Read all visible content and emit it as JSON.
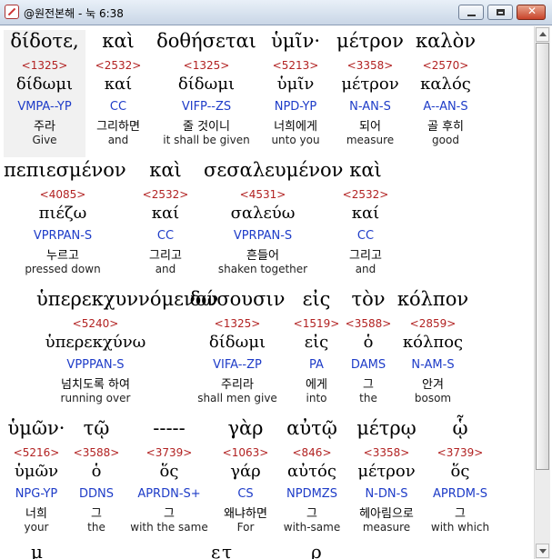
{
  "window": {
    "title": "@원전본해 - 눅 6:38",
    "minimize_label": "minimize",
    "maximize_label": "maximize",
    "close_label": "✕"
  },
  "rows": [
    {
      "words": [
        {
          "greek": "δίδοτε,",
          "strong": "<1325>",
          "lemma": "δίδωμι",
          "parse": "VMPA--YP",
          "korean": "주라",
          "english": "Give"
        },
        {
          "greek": "καὶ",
          "strong": "<2532>",
          "lemma": "καί",
          "parse": "CC",
          "korean": "그리하면",
          "english": "and"
        },
        {
          "greek": "δοθήσεται",
          "strong": "<1325>",
          "lemma": "δίδωμι",
          "parse": "VIFP--ZS",
          "korean": "줄 것이니",
          "english": "it shall be given"
        },
        {
          "greek": "ὑμῖν·",
          "strong": "<5213>",
          "lemma": "ὑμῖν",
          "parse": "NPD-YP",
          "korean": "너희에게",
          "english": "unto you"
        },
        {
          "greek": "μέτρον",
          "strong": "<3358>",
          "lemma": "μέτρον",
          "parse": "N-AN-S",
          "korean": "되어",
          "english": "measure"
        },
        {
          "greek": "καλὸν",
          "strong": "<2570>",
          "lemma": "καλός",
          "parse": "A--AN-S",
          "korean": "골 후히",
          "english": "good"
        }
      ]
    },
    {
      "words": [
        {
          "greek": "πεπιεσμένον",
          "strong": "<4085>",
          "lemma": "πιέζω",
          "parse": "VPRPAN-S",
          "korean": "누르고",
          "english": "pressed down"
        },
        {
          "greek": "καὶ",
          "strong": "<2532>",
          "lemma": "καί",
          "parse": "CC",
          "korean": "그리고",
          "english": "and"
        },
        {
          "greek": "σεσαλευμένον",
          "strong": "<4531>",
          "lemma": "σαλεύω",
          "parse": "VPRPAN-S",
          "korean": "흔들어",
          "english": "shaken together"
        },
        {
          "greek": "καὶ",
          "strong": "<2532>",
          "lemma": "καί",
          "parse": "CC",
          "korean": "그리고",
          "english": "and"
        }
      ]
    },
    {
      "words": [
        {
          "greek": "ὑπερεκχυννόμενον",
          "strong": "<5240>",
          "lemma": "ὑπερεκχύνω",
          "parse": "VPPPAN-S",
          "korean": "넘치도록 하여",
          "english": "running over"
        },
        {
          "greek": "δώσουσιν",
          "strong": "<1325>",
          "lemma": "δίδωμι",
          "parse": "VIFA--ZP",
          "korean": "주리라",
          "english": "shall men give"
        },
        {
          "greek": "εἰς",
          "strong": "<1519>",
          "lemma": "εἰς",
          "parse": "PA",
          "korean": "에게",
          "english": "into"
        },
        {
          "greek": "τὸν",
          "strong": "<3588>",
          "lemma": "ὁ",
          "parse": "DAMS",
          "korean": "그",
          "english": "the"
        },
        {
          "greek": "κόλπον",
          "strong": "<2859>",
          "lemma": "κόλπος",
          "parse": "N-AM-S",
          "korean": "안겨",
          "english": "bosom"
        }
      ]
    },
    {
      "words": [
        {
          "greek": "ὑμῶν·",
          "strong": "<5216>",
          "lemma": "ὑμῶν",
          "parse": "NPG-YP",
          "korean": "너희",
          "english": "your"
        },
        {
          "greek": "τῷ",
          "strong": "<3588>",
          "lemma": "ὁ",
          "parse": "DDNS",
          "korean": "그",
          "english": "the"
        },
        {
          "greek": "-----",
          "strong": "<3739>",
          "lemma": "ὅς",
          "parse": "APRDN-S+",
          "korean": "그",
          "english": "with the same"
        },
        {
          "greek": "γὰρ",
          "strong": "<1063>",
          "lemma": "γάρ",
          "parse": "CS",
          "korean": "왜냐하면",
          "english": "For"
        },
        {
          "greek": "αὐτῷ",
          "strong": "<846>",
          "lemma": "αὐτός",
          "parse": "NPDMZS",
          "korean": "그",
          "english": "with-same"
        },
        {
          "greek": "μέτρῳ",
          "strong": "<3358>",
          "lemma": "μέτρον",
          "parse": "N-DN-S",
          "korean": "헤아림으로",
          "english": "measure"
        },
        {
          "greek": "ᾧ",
          "strong": "<3739>",
          "lemma": "ὅς",
          "parse": "APRDM-S",
          "korean": "그",
          "english": "with which"
        }
      ]
    }
  ],
  "cutoff_glyphs": [
    "μ",
    "ε",
    "τ",
    "ρ"
  ]
}
